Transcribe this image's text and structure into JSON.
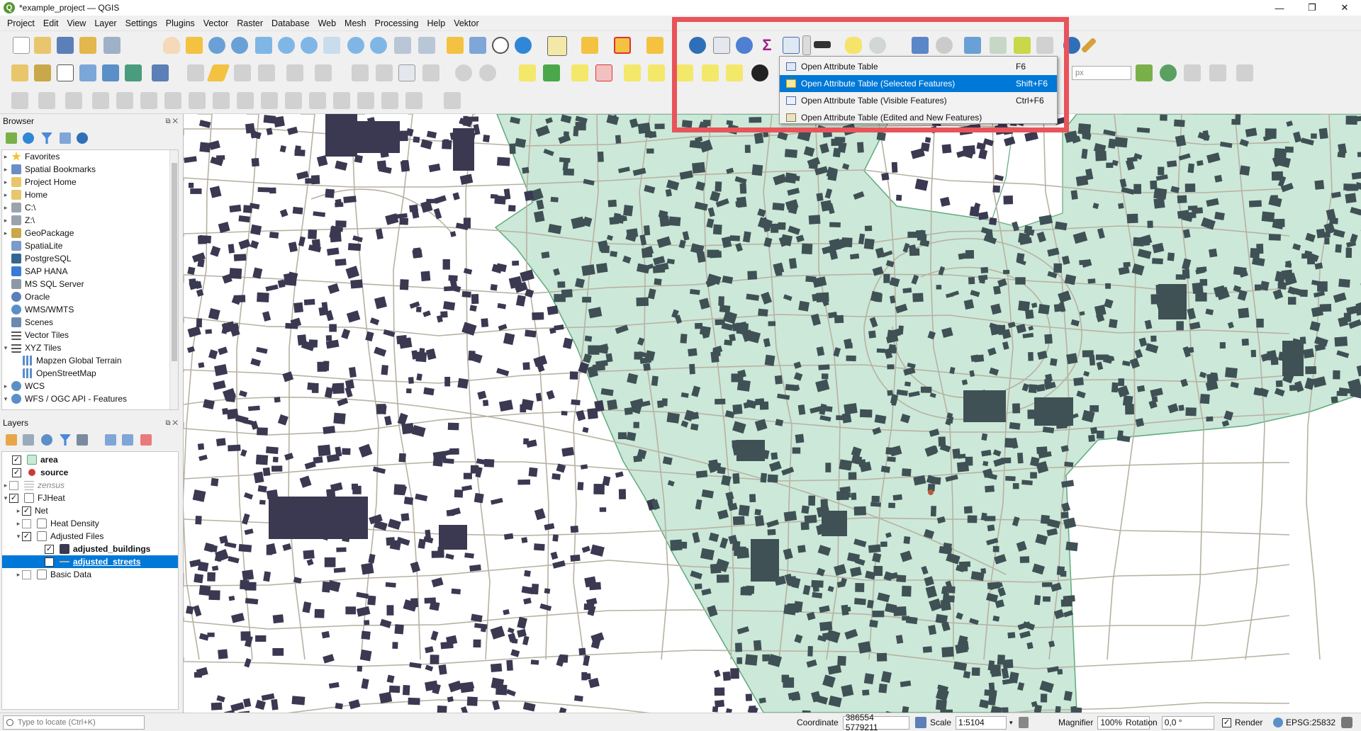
{
  "window": {
    "title": "*example_project — QGIS",
    "minimize": "—",
    "maximize": "❐",
    "close": "✕"
  },
  "menubar": [
    "Project",
    "Edit",
    "View",
    "Layer",
    "Settings",
    "Plugins",
    "Vector",
    "Raster",
    "Database",
    "Web",
    "Mesh",
    "Processing",
    "Help",
    "Vektor"
  ],
  "browser": {
    "title": "Browser",
    "items": [
      {
        "label": "Favorites",
        "icon": "star-icon",
        "color": "#f2c230"
      },
      {
        "label": "Spatial Bookmarks",
        "icon": "bookmark-icon",
        "color": "#6a8fc7"
      },
      {
        "label": "Project Home",
        "icon": "folder-icon",
        "color": "#e9c66b"
      },
      {
        "label": "Home",
        "icon": "folder-icon",
        "color": "#e9c66b"
      },
      {
        "label": "C:\\",
        "icon": "drive-icon",
        "color": "#9ba4ad"
      },
      {
        "label": "Z:\\",
        "icon": "drive-icon",
        "color": "#9ba4ad"
      },
      {
        "label": "GeoPackage",
        "icon": "geopackage-icon",
        "color": "#c9a84a"
      },
      {
        "label": "SpatiaLite",
        "icon": "spatialite-icon",
        "color": "#7a9bc9"
      },
      {
        "label": "PostgreSQL",
        "icon": "postgresql-icon",
        "color": "#336791"
      },
      {
        "label": "SAP HANA",
        "icon": "sap-hana-icon",
        "color": "#3a7bd5"
      },
      {
        "label": "MS SQL Server",
        "icon": "mssql-icon",
        "color": "#8d98a6"
      },
      {
        "label": "Oracle",
        "icon": "oracle-icon",
        "color": "#5b7fb6"
      },
      {
        "label": "WMS/WMTS",
        "icon": "globe-icon",
        "color": "#5b8fc7"
      },
      {
        "label": "Scenes",
        "icon": "scenes-icon",
        "color": "#6b8ab0"
      },
      {
        "label": "Vector Tiles",
        "icon": "grid-icon",
        "color": "#555555"
      },
      {
        "label": "XYZ Tiles",
        "icon": "grid-icon",
        "color": "#555555"
      },
      {
        "label": "Mapzen Global Terrain",
        "icon": "tiles-icon",
        "color": "#5a8ccc"
      },
      {
        "label": "OpenStreetMap",
        "icon": "tiles-icon",
        "color": "#5a8ccc"
      },
      {
        "label": "WCS",
        "icon": "globe-icon",
        "color": "#5b8fc7"
      },
      {
        "label": "WFS / OGC API - Features",
        "icon": "wfs-icon",
        "color": "#5b8fc7"
      }
    ]
  },
  "layers": {
    "title": "Layers",
    "items": [
      {
        "label": "area",
        "checked": "✓"
      },
      {
        "label": "source",
        "checked": "✓"
      },
      {
        "label": "zensus",
        "checked": ""
      },
      {
        "label": "FJHeat",
        "checked": "✓"
      },
      {
        "label": "Net",
        "checked": "✓"
      },
      {
        "label": "Heat Density",
        "checked": ""
      },
      {
        "label": "Adjusted Files",
        "checked": "✓"
      },
      {
        "label": "adjusted_buildings",
        "checked": "✓"
      },
      {
        "label": "adjusted_streets",
        "checked": "✓"
      },
      {
        "label": "Basic Data",
        "checked": ""
      }
    ]
  },
  "attribute_menu": {
    "items": [
      {
        "label": "Open Attribute Table",
        "shortcut": "F6"
      },
      {
        "label": "Open Attribute Table (Selected Features)",
        "shortcut": "Shift+F6"
      },
      {
        "label": "Open Attribute Table (Visible Features)",
        "shortcut": "Ctrl+F6"
      },
      {
        "label": "Open Attribute Table (Edited and New Features)",
        "shortcut": ""
      }
    ]
  },
  "toolbar": {
    "unit_select": "px"
  },
  "statusbar": {
    "locate_placeholder": "Type to locate (Ctrl+K)",
    "coordinate_label": "Coordinate",
    "coordinate_value": "386554  5779211",
    "scale_label": "Scale",
    "scale_value": "1:5104",
    "magnifier_label": "Magnifier",
    "magnifier_value": "100%",
    "rotation_label": "Rotation",
    "rotation_value": "0,0 °",
    "render_label": "Render",
    "crs": "EPSG:25832"
  },
  "colors": {
    "highlight_frame": "#e8545a",
    "selection_blue": "#0078d7",
    "area_fill": "#cce8d8",
    "area_stroke": "#5faa7d",
    "building_dark": "#3b3851",
    "building_selected": "#3f5155",
    "street": "#b8b1a2"
  }
}
